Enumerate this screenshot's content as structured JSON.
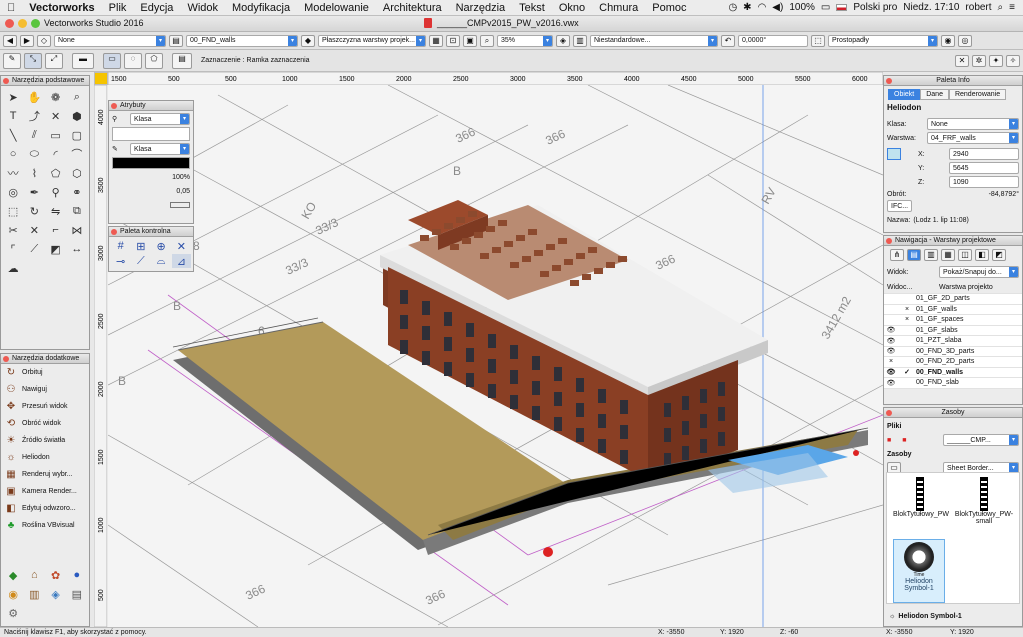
{
  "menubar": {
    "app": "Vectorworks",
    "items": [
      "Plik",
      "Edycja",
      "Widok",
      "Modyfikacja",
      "Modelowanie",
      "Architektura",
      "Narzędzia",
      "Tekst",
      "Okno",
      "Chmura",
      "Pomoc"
    ],
    "battery": "100%",
    "language": "Polski pro",
    "clock": "Niedz. 17:10",
    "user": "robert"
  },
  "window": {
    "app_title": "Vectorworks Studio 2016",
    "doc_title": "______CMPv2015_PW_v2016.vwx"
  },
  "toolbar": {
    "class_select": "None",
    "layer_select": "00_FND_walls",
    "plane_select": "Płaszczyzna warstwy projek...",
    "zoom": "35%",
    "render_mode": "Niestandardowe...",
    "rotation": "0,0000°",
    "view_select": "Prostopadły",
    "selection_hint": "Zaznaczenie : Ramka zaznaczenia"
  },
  "ruler": {
    "top": [
      "1500",
      "500",
      "500",
      "1000",
      "1500",
      "2000",
      "2500",
      "3000",
      "3500",
      "4000",
      "4500",
      "5000",
      "5500",
      "6000"
    ],
    "left": [
      "4000",
      "3500",
      "3000",
      "2500",
      "2000",
      "1500",
      "1000",
      "500"
    ]
  },
  "basic_tools": {
    "title": "Narzędzia podstawowe"
  },
  "extra_tools": {
    "title": "Narzędzia dodatkowe",
    "items": [
      "Orbituj",
      "Nawiguj",
      "Przesuń widok",
      "Obróć widok",
      "Źródło światła",
      "Heliodon",
      "Renderuj wybr...",
      "Kamera Render...",
      "Edytuj odwzoro...",
      "Roślina VBvisual"
    ]
  },
  "attributes": {
    "title": "Atrybuty",
    "fill_class": "Klasa",
    "pen_class": "Klasa",
    "opacity": "100%",
    "line_weight": "0,05"
  },
  "control_palette": {
    "title": "Paleta kontrolna"
  },
  "info": {
    "title": "Paleta Info",
    "tabs": [
      "Obiekt",
      "Dane",
      "Renderowanie"
    ],
    "object": "Heliodon",
    "class_label": "Klasa:",
    "class_value": "None",
    "layer_label": "Warstwa:",
    "layer_value": "04_FRF_walls",
    "x": "2940",
    "y": "5645",
    "z": "1090",
    "rotation_label": "Obrót:",
    "rotation_value": "-84,8792°",
    "ifc": "IFC...",
    "name_label": "Nazwa:",
    "name_value": "(Lodz 1. lip 11:08)"
  },
  "navigation": {
    "title": "Nawigacja - Warstwy projektowe",
    "view_label": "Widok:",
    "view_value": "Pokaż/Snapuj do...",
    "col_visibility": "Widoc...",
    "col_layer": "Warstwa projekto",
    "layers": [
      {
        "vis": "",
        "mark": "",
        "name": "01_GF_2D_parts"
      },
      {
        "vis": "",
        "mark": "×",
        "name": "01_GF_walls"
      },
      {
        "vis": "",
        "mark": "×",
        "name": "01_GF_spaces"
      },
      {
        "vis": "👁",
        "mark": "",
        "name": "01_GF_slabs"
      },
      {
        "vis": "👁",
        "mark": "",
        "name": "01_PZT_slaba"
      },
      {
        "vis": "👁",
        "mark": "",
        "name": "00_FND_3D_parts"
      },
      {
        "vis": "×",
        "mark": "",
        "name": "00_FND_2D_parts"
      },
      {
        "vis": "👁",
        "mark": "✓",
        "name": "00_FND_walls"
      },
      {
        "vis": "👁",
        "mark": "",
        "name": "00_FND_slab"
      }
    ]
  },
  "resources": {
    "title": "Zasoby",
    "files_label": "Pliki",
    "file_value": "______CMP...",
    "resources_label": "Zasoby",
    "filter_value": "Sheet Border...",
    "items": [
      "BlokTytułowy_PW",
      "BlokTytułowy_PW-small",
      "Heliodon Symbol-1"
    ],
    "sun_caption": "Time",
    "selected": "Heliodon Symbol-1"
  },
  "canvas_labels": [
    "366",
    "366",
    "366",
    "33/3",
    "33/3",
    "KO",
    "RV",
    "A",
    "B",
    "B",
    "B",
    "6",
    "7",
    "8",
    "3412 m2",
    "366",
    "366",
    "6"
  ],
  "status": {
    "hint": "Naciśnij klawisz F1, aby skorzystać z pomocy.",
    "x": "X: -3550",
    "y": "Y: 1920",
    "z": "Z: -60",
    "x2": "X: -3550",
    "y2": "Y: 1920"
  }
}
